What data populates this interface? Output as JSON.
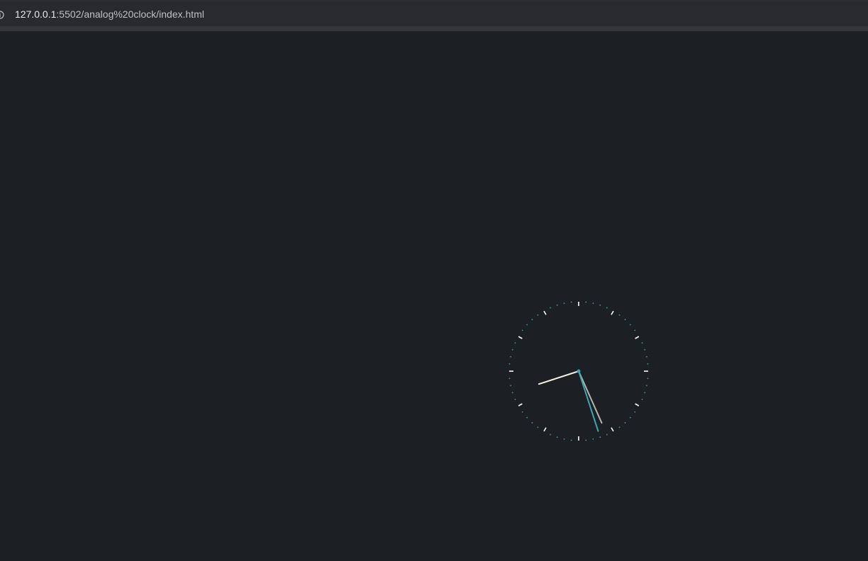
{
  "browser": {
    "url_host": "127.0.0.1",
    "url_rest": ":5502/analog%20clock/index.html",
    "info_icon": "info-icon"
  },
  "clock": {
    "hour_hand_value": 8.4,
    "minute_hand_value": 26,
    "second_hand_value": 27,
    "colors": {
      "face_background": "#1c1f23",
      "hour_marker": "#ffffff",
      "minute_dot": "#3aa0b0",
      "hour_hand": "#f5f0e6",
      "minute_hand": "#b9b3aa",
      "second_hand": "#3aa6b8",
      "center_dot": "#3aa6b8"
    }
  }
}
